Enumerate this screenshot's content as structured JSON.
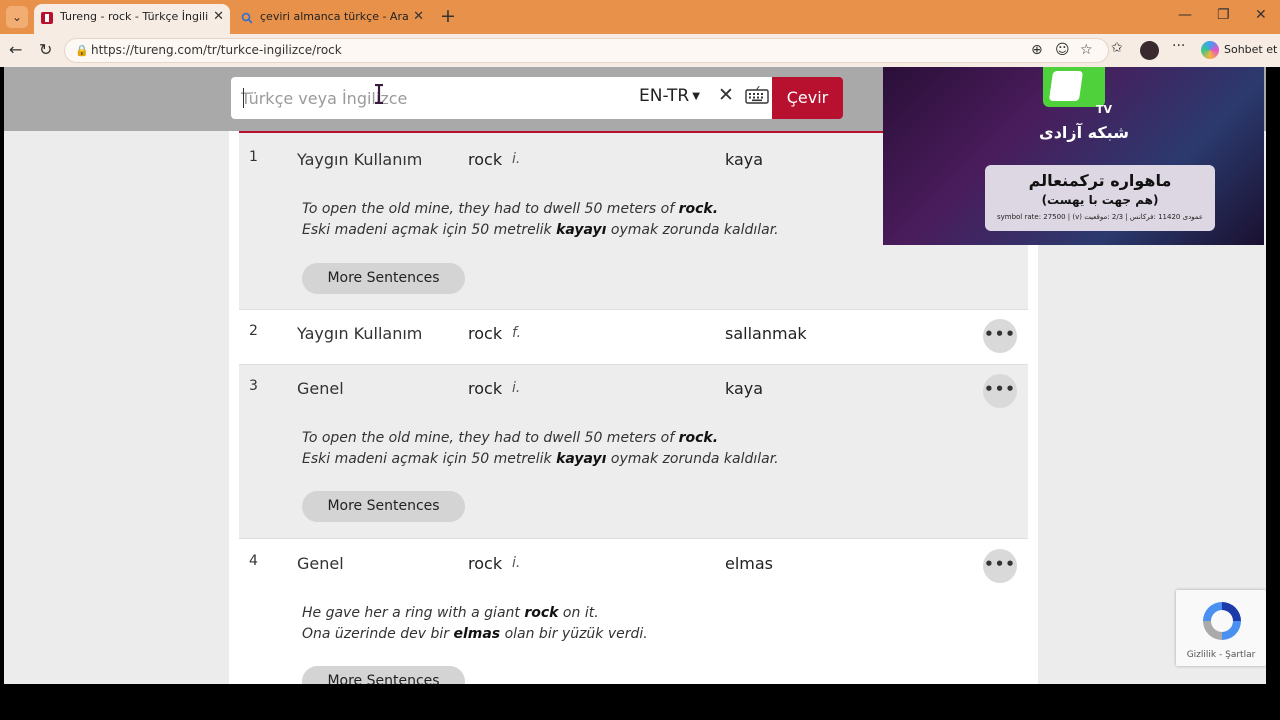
{
  "browser": {
    "tabs": [
      {
        "title": "Tureng - rock - Türkçe İngilizce Sözlük",
        "active": true
      },
      {
        "title": "çeviri almanca türkçe - Arama",
        "active": false
      }
    ],
    "url": "https://tureng.com/tr/turkce-ingilizce/rock",
    "copilot_label": "Sohbet et"
  },
  "search": {
    "placeholder": "Türkçe veya İngilizce",
    "language": "EN-TR",
    "button_label": "Çevir"
  },
  "results": [
    {
      "num": "1",
      "category": "Yaygın Kullanım",
      "english": "rock",
      "pos": "i.",
      "turkish": "kaya",
      "example_en": [
        "To open the old mine, they had to dwell 50 meters of ",
        "rock",
        "."
      ],
      "example_tr": [
        "Eski madeni açmak için 50 metrelik ",
        "kayayı",
        " oymak zorunda kaldılar."
      ],
      "more_label": "More Sentences"
    },
    {
      "num": "2",
      "category": "Yaygın Kullanım",
      "english": "rock",
      "pos": "f.",
      "turkish": "sallanmak"
    },
    {
      "num": "3",
      "category": "Genel",
      "english": "rock",
      "pos": "i.",
      "turkish": "kaya",
      "example_en": [
        "To open the old mine, they had to dwell 50 meters of ",
        "rock",
        "."
      ],
      "example_tr": [
        "Eski madeni açmak için 50 metrelik ",
        "kayayı",
        " oymak zorunda kaldılar."
      ],
      "more_label": "More Sentences"
    },
    {
      "num": "4",
      "category": "Genel",
      "english": "rock",
      "pos": "i.",
      "turkish": "elmas",
      "example_en": [
        "He gave her a ring with a giant ",
        "rock",
        " on it."
      ],
      "example_tr": [
        "Ona üzerinde dev bir ",
        "elmas",
        " olan bir yüzük verdi."
      ],
      "more_label": "More Sentences"
    }
  ],
  "ad": {
    "tv": "TV",
    "channel": "شبکه آزادی",
    "line1": "ماهواره ترکمنعالم",
    "line2": "(هم جهت با يهست)",
    "line3": "symbol rate: 27500 | (v) عمودی 11420 :فرکانس | 2/3 :موقعیت"
  },
  "recaptcha": {
    "privacy": "Gizlilik",
    "separator": " - ",
    "terms": "Şartlar"
  },
  "icons": {
    "accent": "#b8102f",
    "tabbar": "#e8914a"
  }
}
